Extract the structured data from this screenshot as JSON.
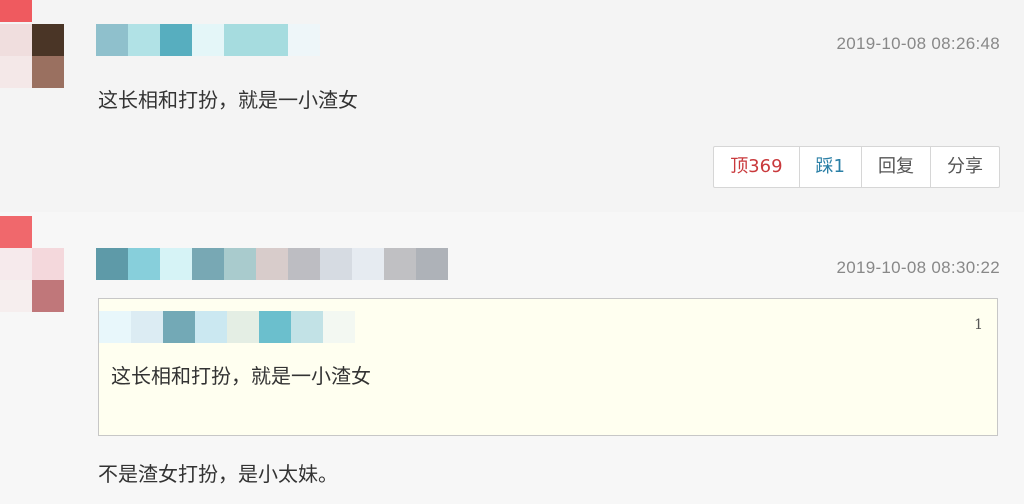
{
  "colors": {
    "vote_up": "#c9393c",
    "vote_down": "#2a7fa6",
    "quote_background": "#fffff0"
  },
  "comments": [
    {
      "username_hidden": "pixelated-username",
      "avatar_hidden": "pixelated-avatar",
      "timestamp": "2019-10-08 08:26:48",
      "text": "这长相和打扮，就是一小渣女",
      "actions": {
        "up_label": "顶369",
        "down_label": "踩1",
        "reply_label": "回复",
        "share_label": "分享"
      }
    },
    {
      "username_hidden": "pixelated-username",
      "avatar_hidden": "pixelated-avatar",
      "timestamp": "2019-10-08 08:30:22",
      "quote": {
        "username_hidden": "pixelated-username",
        "floor": "1",
        "text": "这长相和打扮，就是一小渣女"
      },
      "text": "不是渣女打扮，是小太妹。"
    }
  ]
}
